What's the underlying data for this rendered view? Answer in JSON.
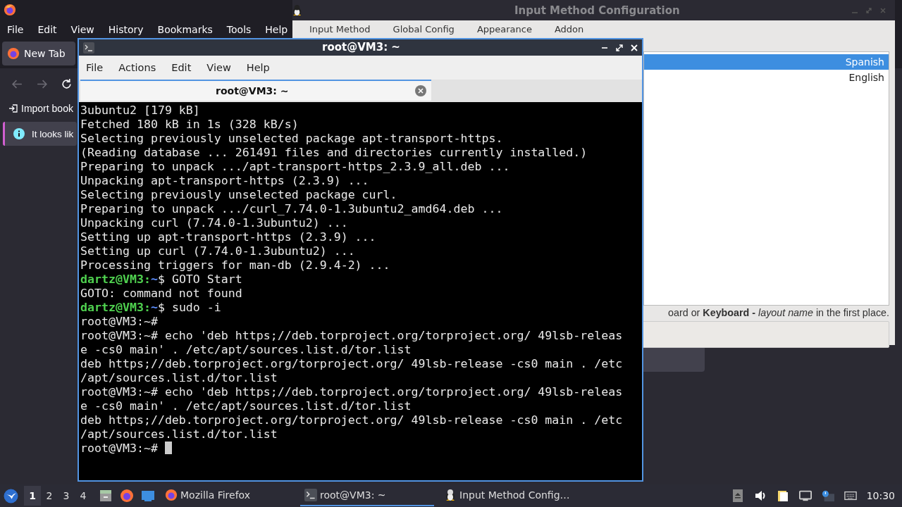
{
  "firefox": {
    "menu": [
      "File",
      "Edit",
      "View",
      "History",
      "Bookmarks",
      "Tools",
      "Help"
    ],
    "tab": "New Tab",
    "bookmark": "Import book",
    "notice": "It looks lik"
  },
  "im_window": {
    "title": "Input Method Configuration",
    "tabs": [
      "Input Method",
      "Global Config",
      "Appearance",
      "Addon"
    ],
    "list": [
      {
        "label": "Spanish",
        "selected": true
      },
      {
        "label": "English",
        "selected": false
      }
    ],
    "hint": "oard or **Keyboard -** *layout name* in the first place."
  },
  "terminal": {
    "title": "root@VM3: ~",
    "menu": [
      "File",
      "Actions",
      "Edit",
      "View",
      "Help"
    ],
    "tab": "root@VM3: ~",
    "lines": [
      {
        "kind": "output",
        "text": "3ubuntu2 [179 kB]"
      },
      {
        "kind": "output",
        "text": "Fetched 180 kB in 1s (328 kB/s)"
      },
      {
        "kind": "output",
        "text": "Selecting previously unselected package apt-transport-https."
      },
      {
        "kind": "output",
        "text": "(Reading database ... 261491 files and directories currently installed.)"
      },
      {
        "kind": "output",
        "text": "Preparing to unpack .../apt-transport-https_2.3.9_all.deb ..."
      },
      {
        "kind": "output",
        "text": "Unpacking apt-transport-https (2.3.9) ..."
      },
      {
        "kind": "output",
        "text": "Selecting previously unselected package curl."
      },
      {
        "kind": "output",
        "text": "Preparing to unpack .../curl_7.74.0-1.3ubuntu2_amd64.deb ..."
      },
      {
        "kind": "output",
        "text": "Unpacking curl (7.74.0-1.3ubuntu2) ..."
      },
      {
        "kind": "output",
        "text": "Setting up apt-transport-https (2.3.9) ..."
      },
      {
        "kind": "output",
        "text": "Setting up curl (7.74.0-1.3ubuntu2) ..."
      },
      {
        "kind": "output",
        "text": "Processing triggers for man-db (2.9.4-2) ..."
      },
      {
        "kind": "user_prompt",
        "user": "dartz@VM3:",
        "path": "~",
        "text": "$ GOTO Start"
      },
      {
        "kind": "output",
        "text": "GOTO: command not found"
      },
      {
        "kind": "user_prompt",
        "user": "dartz@VM3:",
        "path": "~",
        "text": "$ sudo -i"
      },
      {
        "kind": "output",
        "text": "root@VM3:~#"
      },
      {
        "kind": "output",
        "text": "root@VM3:~# echo 'deb https;//deb.torproject.org/torproject.org/ 49lsb-releas"
      },
      {
        "kind": "output",
        "text": "e -cs0 main' . /etc/apt/sources.list.d/tor.list"
      },
      {
        "kind": "output",
        "text": "deb https;//deb.torproject.org/torproject.org/ 49lsb-release -cs0 main . /etc"
      },
      {
        "kind": "output",
        "text": "/apt/sources.list.d/tor.list"
      },
      {
        "kind": "output",
        "text": "root@VM3:~# echo 'deb https;//deb.torproject.org/torproject.org/ 49lsb-releas"
      },
      {
        "kind": "output",
        "text": "e -cs0 main' . /etc/apt/sources.list.d/tor.list"
      },
      {
        "kind": "output",
        "text": "deb https;//deb.torproject.org/torproject.org/ 49lsb-release -cs0 main . /etc"
      },
      {
        "kind": "output",
        "text": "/apt/sources.list.d/tor.list"
      },
      {
        "kind": "input",
        "text": "root@VM3:~#"
      }
    ]
  },
  "taskbar": {
    "workspaces": [
      {
        "label": "1",
        "selected": true
      },
      {
        "label": "2",
        "selected": false
      },
      {
        "label": "3",
        "selected": false
      },
      {
        "label": "4",
        "selected": false
      }
    ],
    "tasks": [
      {
        "label": "Mozilla Firefox",
        "selected": false
      },
      {
        "label": "root@VM3: ~",
        "selected": true
      },
      {
        "label": "Input Method Config…",
        "selected": false
      }
    ],
    "clock": "10:30"
  }
}
